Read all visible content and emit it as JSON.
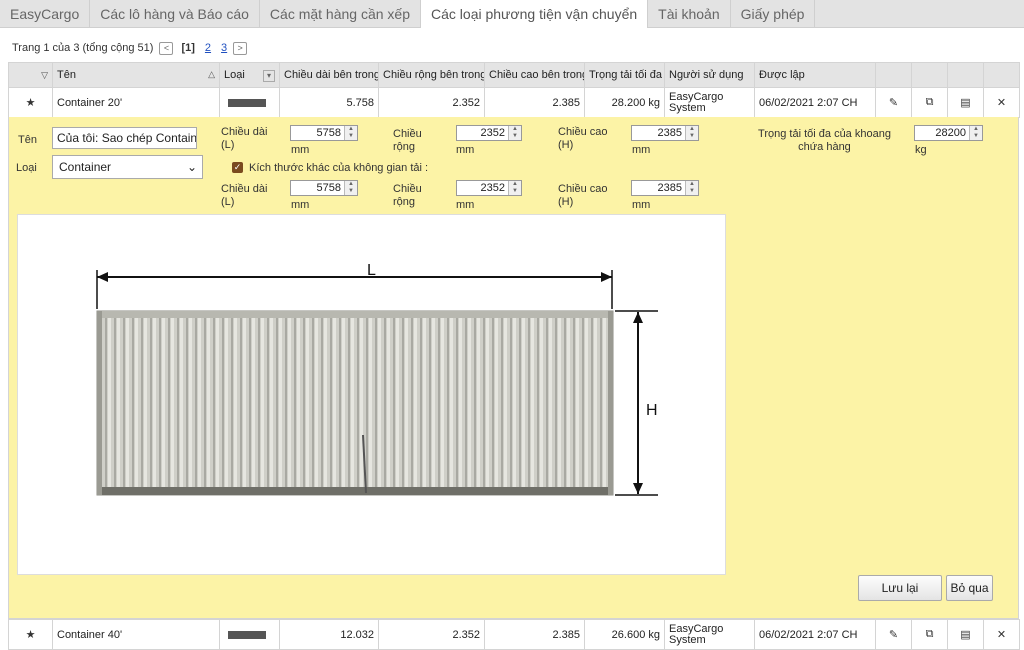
{
  "tabs": [
    {
      "label": "EasyCargo"
    },
    {
      "label": "Các lô hàng và Báo cáo"
    },
    {
      "label": "Các mặt hàng cần xếp"
    },
    {
      "label": "Các loại phương tiện vận chuyển"
    },
    {
      "label": "Tài khoản"
    },
    {
      "label": "Giấy phép"
    }
  ],
  "pager": {
    "summary": "Trang 1 của 3 (tổng cộng 51)",
    "current": "[1]",
    "page2": "2",
    "page3": "3",
    "prev": "<",
    "next": ">"
  },
  "table": {
    "headers": {
      "name": "Tên",
      "type": "Loại",
      "inner_length": "Chiều dài bên trong",
      "inner_width": "Chiều rộng bên trong",
      "inner_height": "Chiều cao bên trong",
      "max_load": "Trọng tải tối đa",
      "user": "Người sử dụng",
      "created": "Được lập"
    },
    "rows": [
      {
        "name": "Container 20'",
        "length": "5.758",
        "width": "2.352",
        "height": "2.385",
        "load": "28.200 kg",
        "user": "EasyCargo System",
        "created": "06/02/2021 2:07 CH"
      },
      {
        "name": "Container 40'",
        "length": "12.032",
        "width": "2.352",
        "height": "2.385",
        "load": "26.600 kg",
        "user": "EasyCargo System",
        "created": "06/02/2021 2:07 CH"
      }
    ]
  },
  "edit": {
    "name_label": "Tên",
    "name_value": "Của tôi: Sao chép Containe",
    "type_label": "Loại",
    "type_value": "Container",
    "length_label": "Chiều dài (L)",
    "width_label": "Chiều rộng",
    "height_label": "Chiều cao (H)",
    "unit": "mm",
    "length_value": "5758",
    "width_value": "2352",
    "height_value": "2385",
    "maxload_label": "Trọng tải tối đa của khoang chứa hàng",
    "maxload_value": "28200",
    "maxload_unit": "kg",
    "other_dims_label": "Kích thước khác của không gian tải :",
    "other_length_value": "5758",
    "other_width_value": "2352",
    "other_height_value": "2385",
    "dim_L": "L",
    "dim_H": "H",
    "save_label": "Lưu lại",
    "cancel_label": "Bỏ qua"
  },
  "colors": {
    "panel_bg": "#fcf3a6",
    "tab_bg": "#e3e3e3",
    "header_bg": "#e4e4e4"
  }
}
